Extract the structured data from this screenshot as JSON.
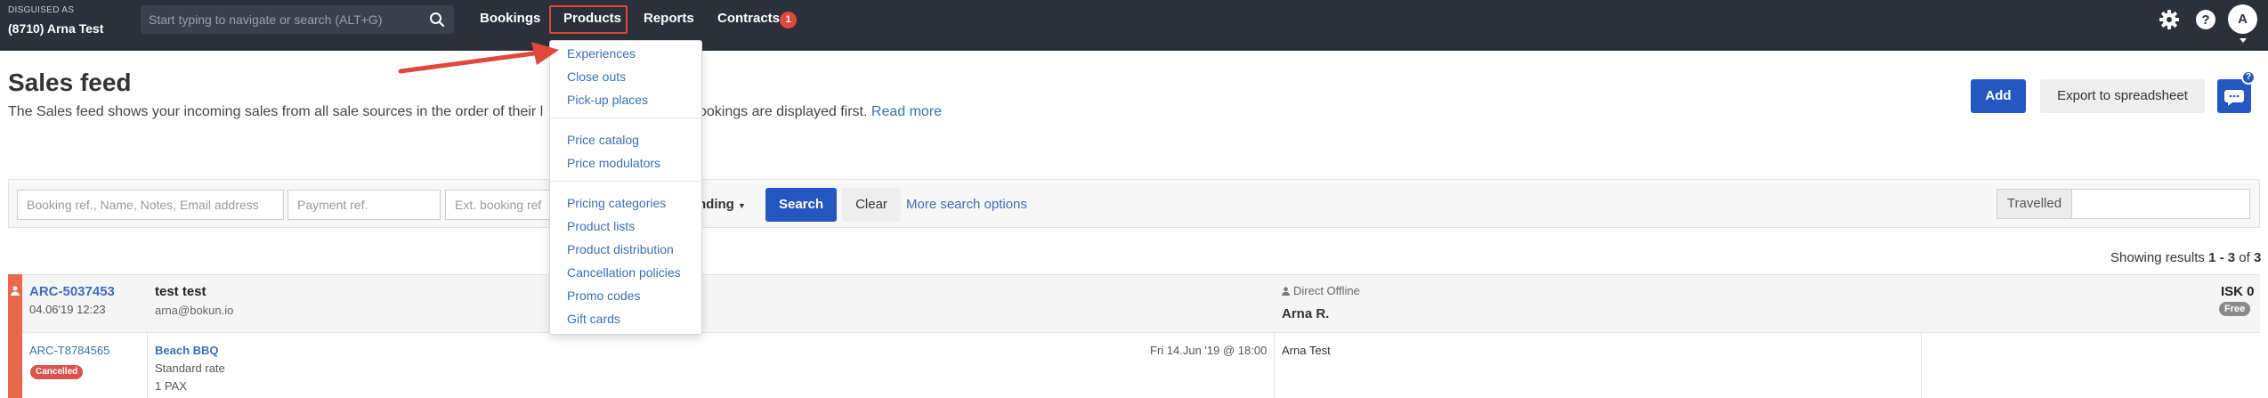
{
  "header": {
    "disguised_label": "DISGUISED AS",
    "account_name": "(8710) Arna Test",
    "search_placeholder": "Start typing to navigate or search (ALT+G)",
    "nav": {
      "bookings": "Bookings",
      "products": "Products",
      "reports": "Reports",
      "contracts": "Contracts",
      "contracts_badge": "1"
    },
    "icons": [
      "gear-icon",
      "help-icon"
    ],
    "avatar_letter": "A"
  },
  "products_menu": {
    "group1": [
      "Experiences",
      "Close outs",
      "Pick-up places"
    ],
    "group2": [
      "Price catalog",
      "Price modulators"
    ],
    "group3": [
      "Pricing categories",
      "Product lists",
      "Product distribution",
      "Cancellation policies",
      "Promo codes",
      "Gift cards"
    ]
  },
  "page": {
    "title": "Sales feed",
    "description_start": "The Sales feed shows your incoming sales from all sale sources in the order of their l",
    "description_end": "ookings are displayed first.",
    "read_more": "Read more",
    "add_button": "Add",
    "export_button": "Export to spreadsheet",
    "chat_badge": "?"
  },
  "filters": {
    "booking_ref_placeholder": "Booking ref., Name, Notes, Email address",
    "payment_ref_placeholder": "Payment ref.",
    "ext_booking_placeholder": "Ext. booking ref",
    "sort_label": "nding",
    "search_button": "Search",
    "clear_button": "Clear",
    "more_options": "More search options",
    "travelled_label": "Travelled"
  },
  "results": {
    "prefix": "Showing results",
    "range": "1 - 3",
    "of": "of",
    "total": "3"
  },
  "bookings": [
    {
      "ref": "ARC-5037453",
      "date": "04.06'19 12:23",
      "customer_name": "test test",
      "customer_email": "arna@bokun.io",
      "source": "Direct Offline",
      "agent": "Arna R.",
      "price": "ISK 0",
      "payment_badge": "Free",
      "sub": {
        "ref": "ARC-T8784565",
        "status": "Cancelled",
        "product": "Beach BBQ",
        "rate": "Standard rate",
        "pax": "1 PAX",
        "when": "Fri 14.Jun '19 @ 18:00",
        "customer": "Arna Test"
      }
    }
  ],
  "colors": {
    "topbar": "#2b303b",
    "primary": "#2656c0",
    "link": "#3b6fb6",
    "highlight": "#e0483b",
    "stripe": "#e9684e"
  }
}
